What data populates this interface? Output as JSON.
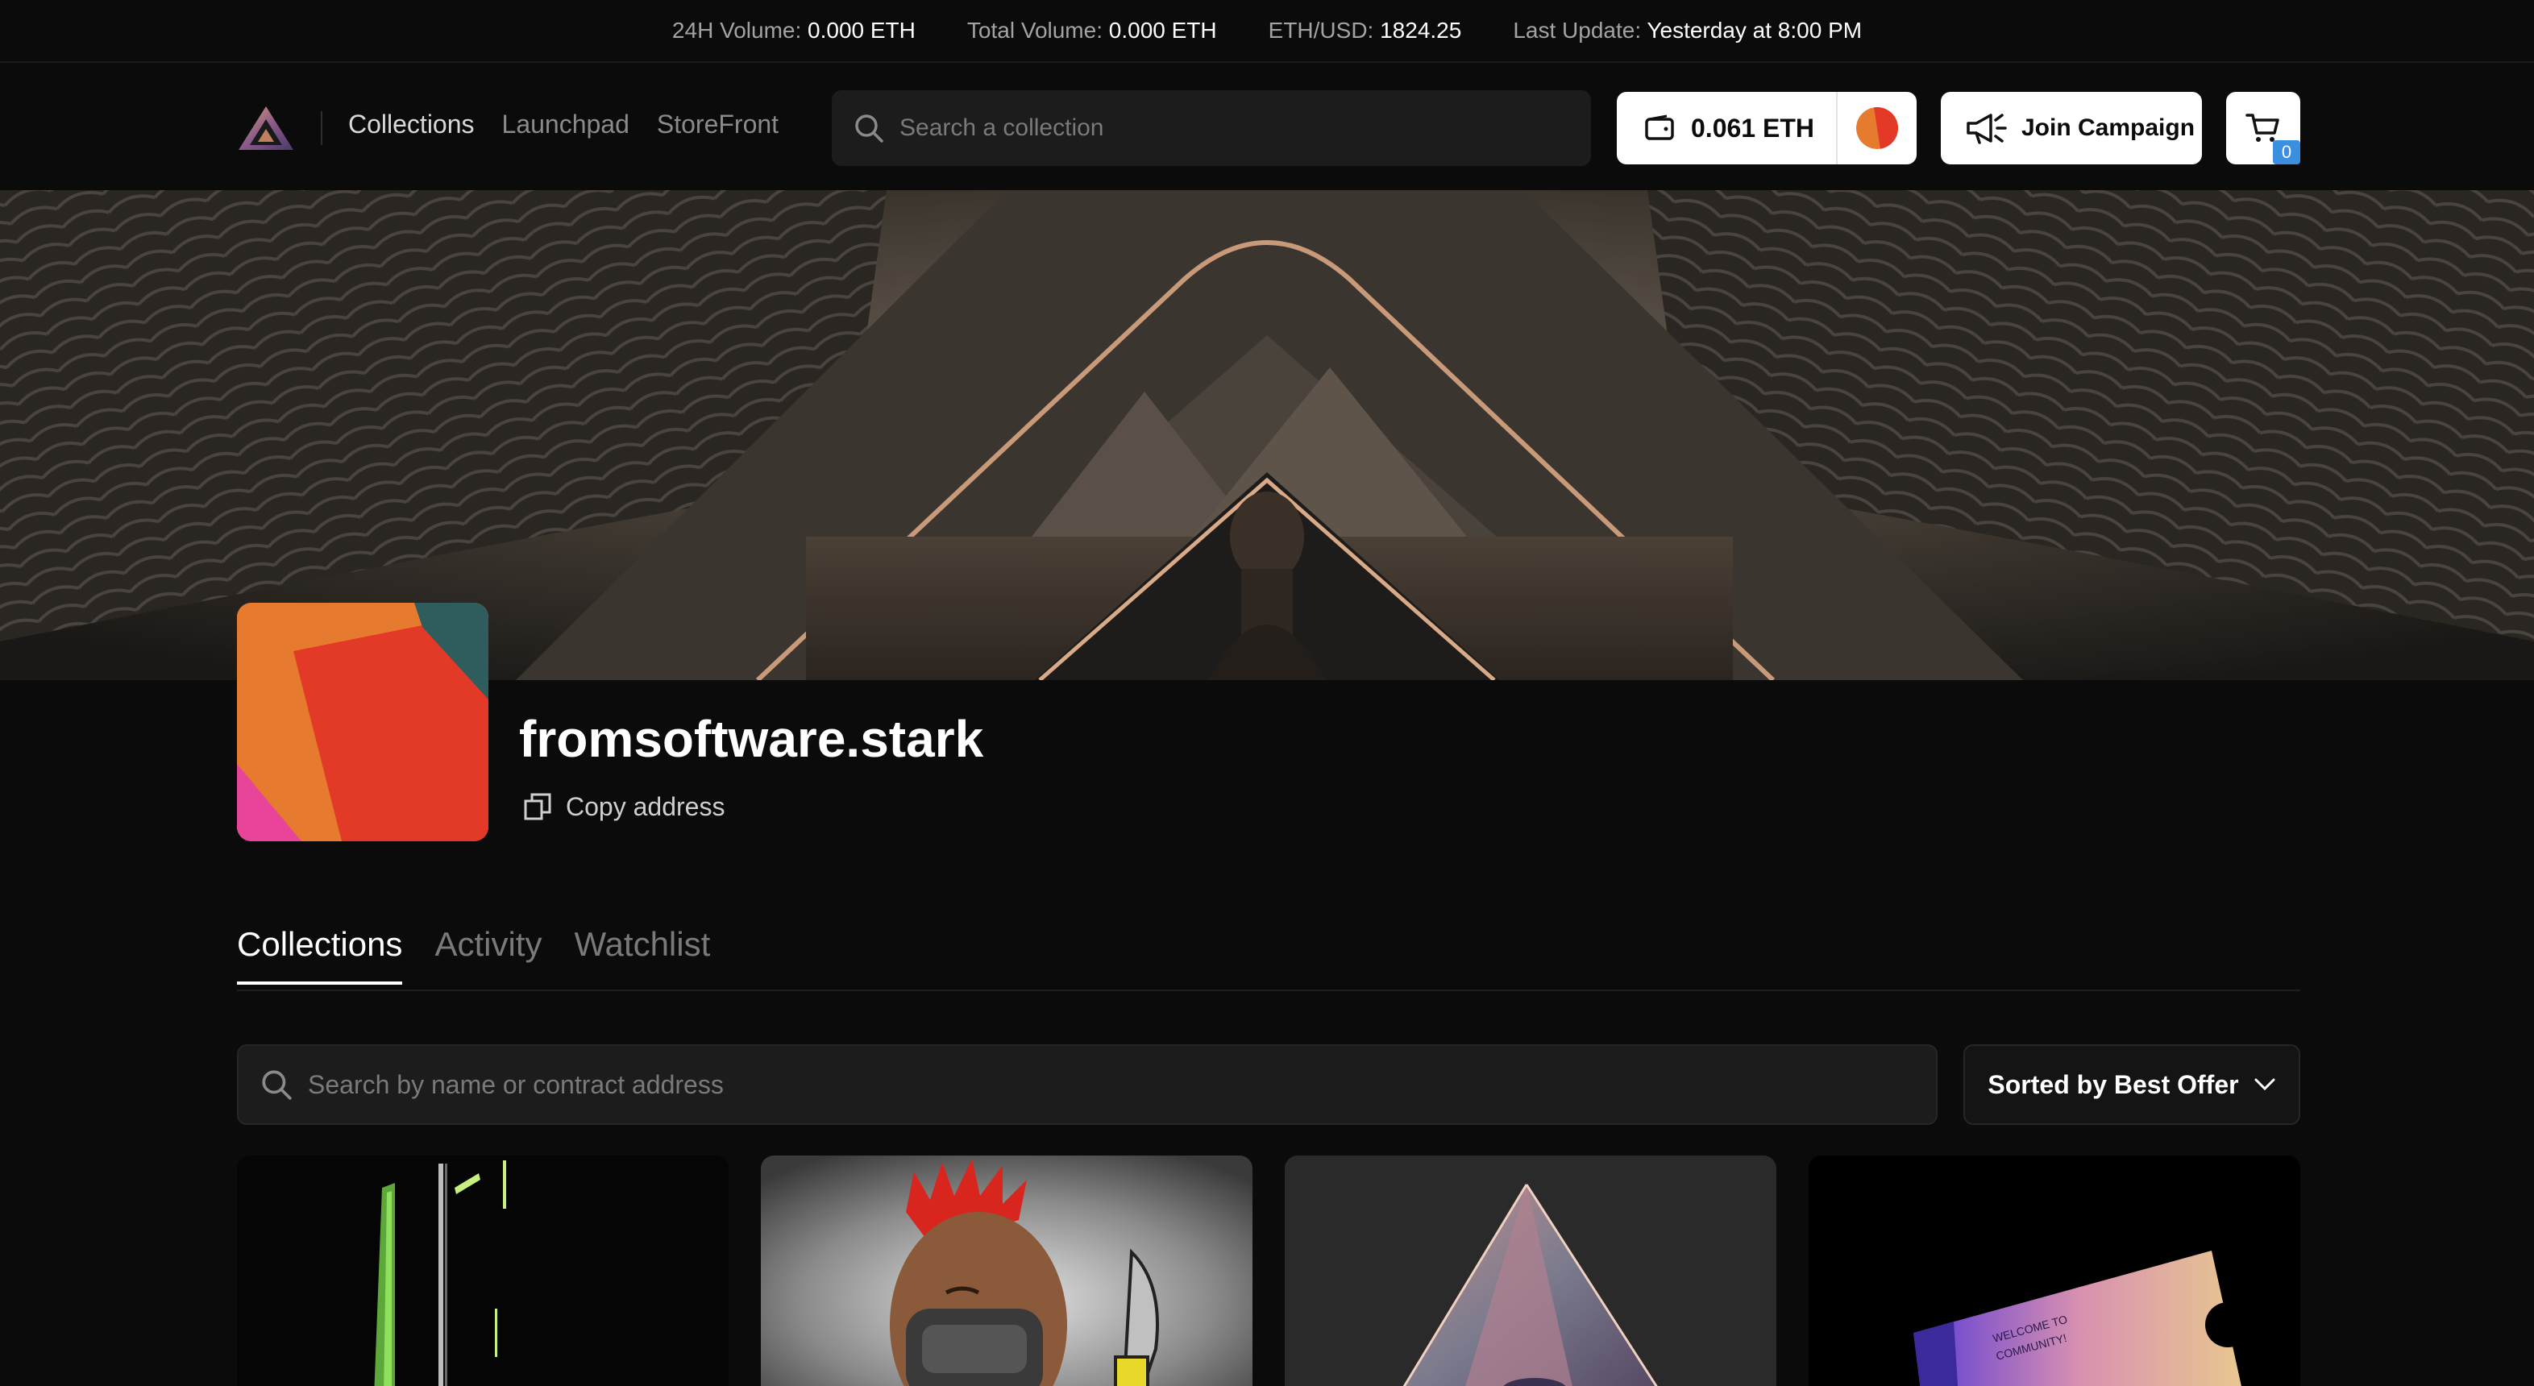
{
  "ticker": [
    {
      "label": "24H Volume:",
      "value": "0.000 ETH"
    },
    {
      "label": "Total Volume:",
      "value": "0.000 ETH"
    },
    {
      "label": "ETH/USD:",
      "value": "1824.25"
    },
    {
      "label": "Last Update:",
      "value": "Yesterday at 8:00 PM"
    }
  ],
  "nav": {
    "items": [
      {
        "label": "Collections",
        "active": true
      },
      {
        "label": "Launchpad"
      },
      {
        "label": "StoreFront"
      }
    ]
  },
  "header": {
    "search_placeholder": "Search a collection",
    "wallet_balance": "0.061 ETH",
    "join_campaign_label": "Join Campaign",
    "cart_count": "0"
  },
  "profile": {
    "name": "fromsoftware.stark",
    "copy_address_label": "Copy address"
  },
  "tabs": [
    {
      "label": "Collections",
      "active": true
    },
    {
      "label": "Activity"
    },
    {
      "label": "Watchlist"
    }
  ],
  "filter": {
    "search_placeholder": "Search by name or contract address",
    "sort_label": "Sorted by Best Offer"
  },
  "cards": [
    {
      "icon": "green-blade-art"
    },
    {
      "icon": "red-mohawk-warrior-art"
    },
    {
      "icon": "glass-pyramid-art"
    },
    {
      "icon": "welcome-ticket-art"
    }
  ],
  "colors": {
    "background": "#0b0b0b",
    "surface": "#1c1c1c",
    "accent_blue": "#3a8fe0",
    "avatar_orange": "#e67a2e",
    "avatar_red": "#e23a26"
  }
}
